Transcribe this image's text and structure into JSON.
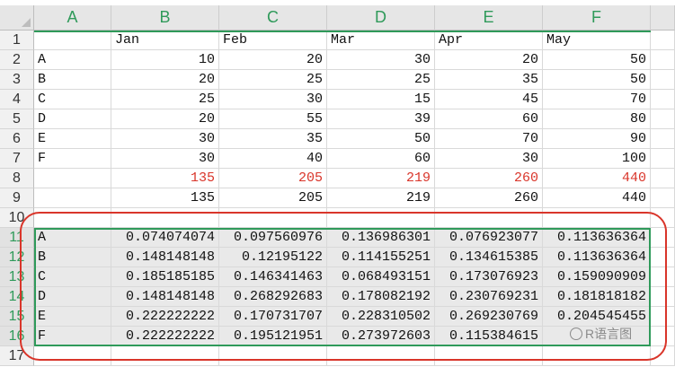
{
  "columns": [
    "A",
    "B",
    "C",
    "D",
    "E",
    "F"
  ],
  "rows": [
    {
      "num": "1",
      "cells": [
        "",
        "Jan",
        "Feb",
        "Mar",
        "Apr",
        "May"
      ]
    },
    {
      "num": "2",
      "cells": [
        "A",
        "10",
        "20",
        "30",
        "20",
        "50"
      ]
    },
    {
      "num": "3",
      "cells": [
        "B",
        "20",
        "25",
        "25",
        "35",
        "50"
      ]
    },
    {
      "num": "4",
      "cells": [
        "C",
        "25",
        "30",
        "15",
        "45",
        "70"
      ]
    },
    {
      "num": "5",
      "cells": [
        "D",
        "20",
        "55",
        "39",
        "60",
        "80"
      ]
    },
    {
      "num": "6",
      "cells": [
        "E",
        "30",
        "35",
        "50",
        "70",
        "90"
      ]
    },
    {
      "num": "7",
      "cells": [
        "F",
        "30",
        "40",
        "60",
        "30",
        "100"
      ]
    },
    {
      "num": "8",
      "cells": [
        "",
        "135",
        "205",
        "219",
        "260",
        "440"
      ]
    },
    {
      "num": "9",
      "cells": [
        "",
        "135",
        "205",
        "219",
        "260",
        "440"
      ]
    },
    {
      "num": "10",
      "cells": [
        "",
        "",
        "",
        "",
        "",
        ""
      ]
    },
    {
      "num": "11",
      "cells": [
        "A",
        "0.074074074",
        "0.097560976",
        "0.136986301",
        "0.076923077",
        "0.113636364"
      ]
    },
    {
      "num": "12",
      "cells": [
        "B",
        "0.148148148",
        "0.12195122",
        "0.114155251",
        "0.134615385",
        "0.113636364"
      ]
    },
    {
      "num": "13",
      "cells": [
        "C",
        "0.185185185",
        "0.146341463",
        "0.068493151",
        "0.173076923",
        "0.159090909"
      ]
    },
    {
      "num": "14",
      "cells": [
        "D",
        "0.148148148",
        "0.268292683",
        "0.178082192",
        "0.230769231",
        "0.181818182"
      ]
    },
    {
      "num": "15",
      "cells": [
        "E",
        "0.222222222",
        "0.170731707",
        "0.228310502",
        "0.269230769",
        "0.204545455"
      ]
    },
    {
      "num": "16",
      "cells": [
        "F",
        "0.222222222",
        "0.195121951",
        "0.273972603",
        "0.115384615",
        ""
      ]
    },
    {
      "num": "17",
      "cells": [
        "",
        "",
        "",
        "",
        "",
        ""
      ]
    }
  ],
  "watermark": {
    "text": "R语言图"
  },
  "colors": {
    "accent": "#2f9a5a",
    "highlight": "#d9352a"
  }
}
